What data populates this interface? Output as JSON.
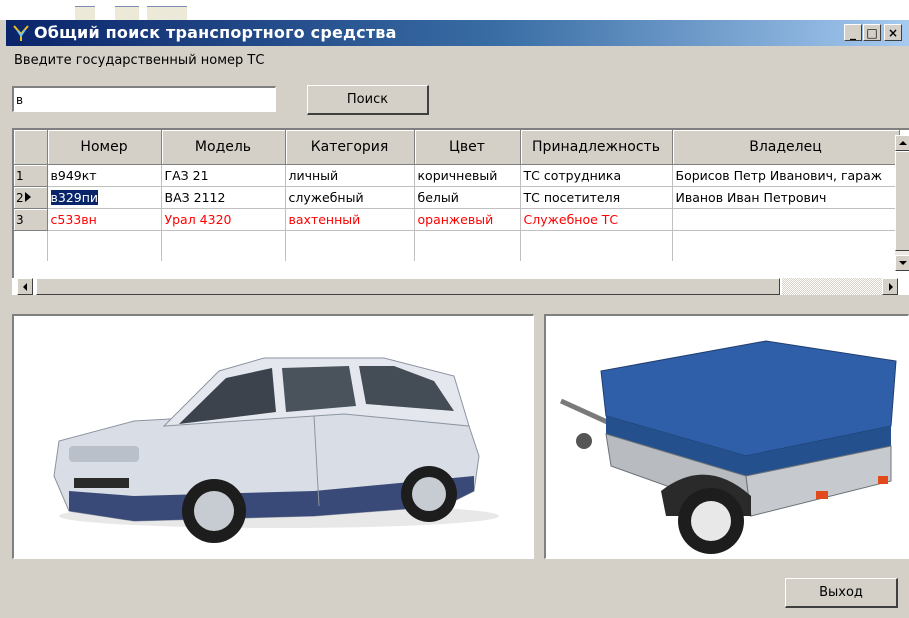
{
  "window": {
    "title": "Общий поиск транспортного средства",
    "minimize": "_",
    "maximize": "□",
    "close": "×"
  },
  "search": {
    "prompt": "Введите государственный номер ТС",
    "value": "в",
    "button_label": "Поиск"
  },
  "table": {
    "columns": [
      "Номер",
      "Модель",
      "Категория",
      "Цвет",
      "Принадлежность",
      "Владелец"
    ],
    "rows": [
      {
        "index": "1",
        "cells": [
          "в949кт",
          "ГАЗ 21",
          "личный",
          "коричневый",
          "ТС сотрудника",
          "Борисов Петр Иванович, гараж"
        ]
      },
      {
        "index": "2",
        "cells": [
          "в329пи",
          "ВАЗ 2112",
          "служебный",
          "белый",
          "ТС посетителя",
          "Иванов Иван Петрович"
        ]
      },
      {
        "index": "3",
        "cells": [
          "с533вн",
          "Урал 4320",
          "вахтенный",
          "оранжевый",
          "Служебное ТС",
          ""
        ]
      }
    ]
  },
  "photos": {
    "left": "car-photo",
    "right": "trailer-photo"
  },
  "footer": {
    "exit_label": "Выход"
  },
  "colors": {
    "title_bar": "#0a246a",
    "highlight_row_text": "#ff0000",
    "selection": "#0a246a",
    "trailer_cover": "#2f5fa8",
    "car_body": "#d9dee6"
  }
}
